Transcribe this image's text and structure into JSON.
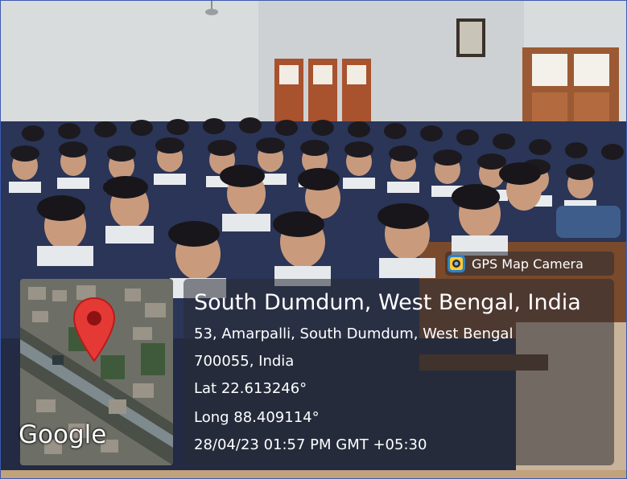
{
  "badge": {
    "app_name": "GPS Map Camera",
    "icon": "gps-map-camera-icon"
  },
  "location": {
    "title": "South Dumdum, West Bengal, India",
    "address_line1": "53, Amarpalli, South Dumdum, West Bengal",
    "address_line2": "700055, India",
    "latitude": "Lat 22.613246°",
    "longitude": "Long 88.409114°",
    "datetime": "28/04/23 01:57 PM GMT +05:30"
  },
  "map": {
    "provider": "Google",
    "pin_icon": "map-pin-icon",
    "pin_color": "#e53935"
  },
  "colors": {
    "overlay": "#282c34",
    "frame_border": "#3b5bb0"
  }
}
